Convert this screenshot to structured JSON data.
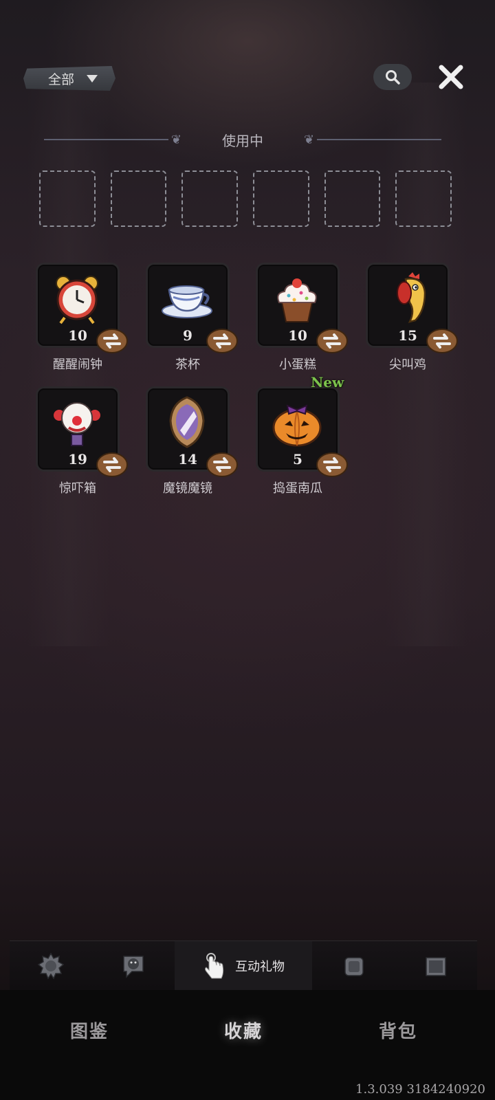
{
  "topbar": {
    "filter_label": "全部"
  },
  "in_use": {
    "title": "使用中",
    "slot_count": 6
  },
  "items": [
    {
      "name": "醒醒闹钟",
      "count": "10",
      "icon": "alarm-clock-icon",
      "new": false
    },
    {
      "name": "茶杯",
      "count": "9",
      "icon": "teacup-icon",
      "new": false
    },
    {
      "name": "小蛋糕",
      "count": "10",
      "icon": "cupcake-icon",
      "new": false
    },
    {
      "name": "尖叫鸡",
      "count": "15",
      "icon": "screaming-chicken-icon",
      "new": false
    },
    {
      "name": "惊吓箱",
      "count": "19",
      "icon": "clown-box-icon",
      "new": false
    },
    {
      "name": "魔镜魔镜",
      "count": "14",
      "icon": "magic-mirror-icon",
      "new": false
    },
    {
      "name": "捣蛋南瓜",
      "count": "5",
      "icon": "pumpkin-icon",
      "new": true,
      "new_label": "New"
    }
  ],
  "category_tabs": [
    {
      "icon": "gear-badge-icon"
    },
    {
      "icon": "emote-face-icon"
    },
    {
      "icon": "tap-hand-icon",
      "label": "互动礼物",
      "active": true
    },
    {
      "icon": "frame-square-icon"
    },
    {
      "icon": "picture-frame-icon"
    }
  ],
  "bottom_nav": {
    "atlas": "图鉴",
    "collection": "收藏",
    "backpack": "背包",
    "active": "collection"
  },
  "version": "1.3.039 3184240920"
}
